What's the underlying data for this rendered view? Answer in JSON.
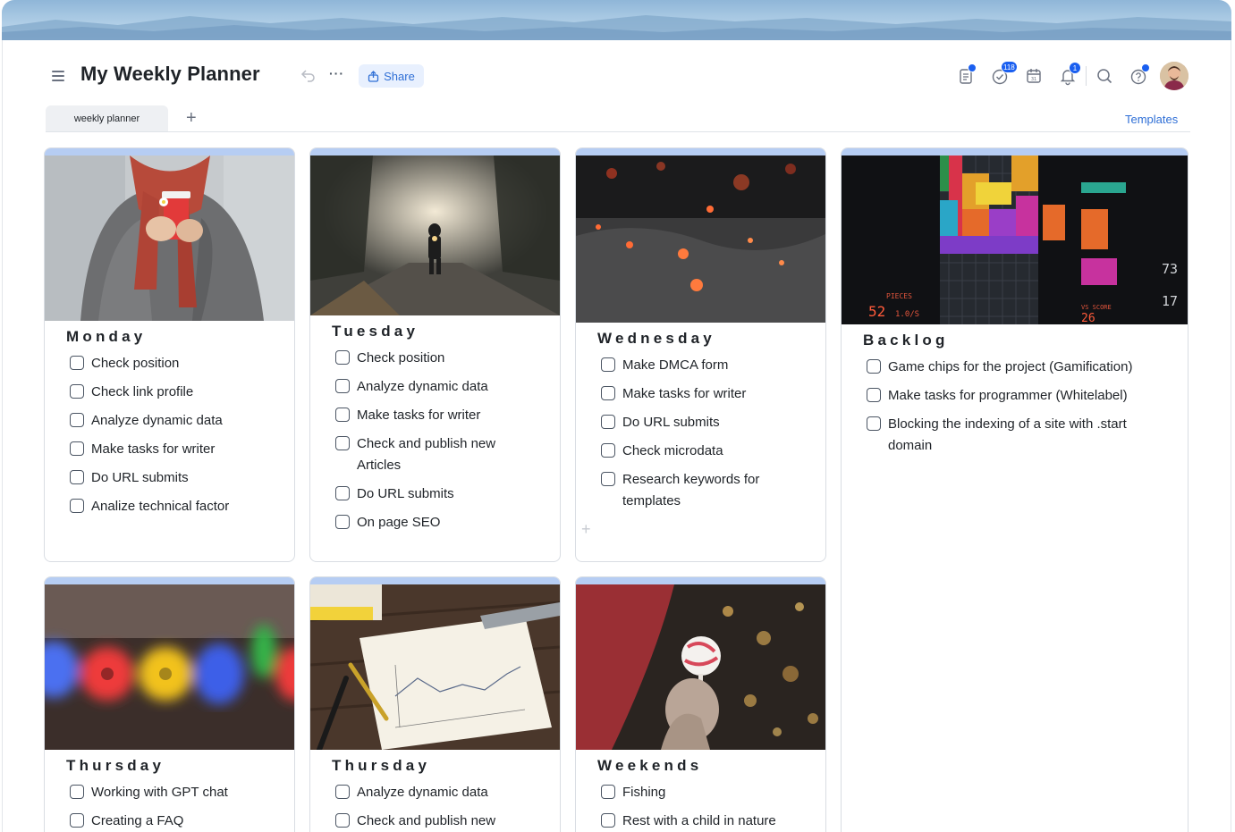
{
  "header": {
    "title": "My Weekly Planner",
    "share_label": "Share",
    "tasks_badge": "118",
    "notifications_badge": "1"
  },
  "tabs": [
    {
      "label": "weekly planner",
      "active": true
    }
  ],
  "templates_label": "Templates",
  "colors": {
    "accent": "#2f6fd6",
    "badge": "#1a5ff0",
    "card_bar": "#b6cdf3"
  },
  "boards": {
    "monday": {
      "title": "Monday",
      "tasks": [
        "Check position",
        "Check link profile",
        "Analyze dynamic data",
        "Make tasks for writer",
        "Do URL submits",
        "Analize technical factor"
      ]
    },
    "tuesday": {
      "title": "Tuesday",
      "tasks": [
        "Check position",
        "Analyze dynamic data",
        "Make tasks for writer",
        "Check and publish new Articles",
        "Do URL submits",
        "On page SEO"
      ]
    },
    "wednesday": {
      "title": "Wednesday",
      "tasks": [
        "Make DMCA form",
        "Make tasks for writer",
        "Do URL submits",
        "Check microdata",
        "Research keywords for templates"
      ]
    },
    "backlog": {
      "title": "Backlog",
      "tasks": [
        "Game chips for the project (Gamification)",
        "Make tasks for programmer (Whitelabel)",
        "Blocking the indexing of a site with .start domain"
      ]
    },
    "thursday1": {
      "title": "Thursday",
      "tasks": [
        "Working with GPT chat",
        "Creating a FAQ"
      ]
    },
    "thursday2": {
      "title": "Thursday",
      "tasks": [
        "Analyze dynamic data",
        "Check and publish new"
      ]
    },
    "weekends": {
      "title": "Weekends",
      "tasks": [
        "Fishing",
        "Rest with a child in nature"
      ]
    }
  },
  "photo_texts": {
    "backlog_pieces": "PIECES",
    "backlog_score": "52",
    "backlog_rate": "1.0/S",
    "backlog_vs": "VS SCORE",
    "backlog_vs_value": "26",
    "backlog_n1": "73",
    "backlog_n2": "17"
  }
}
